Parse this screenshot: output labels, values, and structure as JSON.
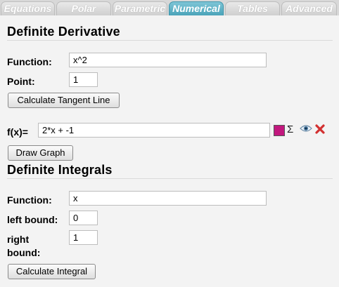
{
  "tabs": [
    {
      "label": "Equations"
    },
    {
      "label": "Polar"
    },
    {
      "label": "Parametric"
    },
    {
      "label": "Numerical",
      "active": true
    },
    {
      "label": "Tables"
    },
    {
      "label": "Advanced"
    }
  ],
  "derivative": {
    "title": "Definite Derivative",
    "function_label": "Function:",
    "function_value": "x^2",
    "point_label": "Point:",
    "point_value": "1",
    "calc_button": "Calculate Tangent Line"
  },
  "graph": {
    "fx_label": "f(x)=",
    "fx_value": "2*x + -1",
    "color": "#c2187e",
    "sigma": "Σ",
    "draw_button": "Draw Graph"
  },
  "integral": {
    "title": "Definite Integrals",
    "function_label": "Function:",
    "function_value": "x",
    "left_label": "left bound:",
    "left_value": "0",
    "right_label_1": "right",
    "right_label_2": "bound:",
    "right_value": "1",
    "calc_button": "Calculate Integral"
  },
  "icons": {
    "color": "swatch-icon",
    "sum": "sigma-icon",
    "view": "eye-icon",
    "remove": "close-icon"
  },
  "colors": {
    "active_tab": "#4aa3b9",
    "remove": "#d23030"
  }
}
